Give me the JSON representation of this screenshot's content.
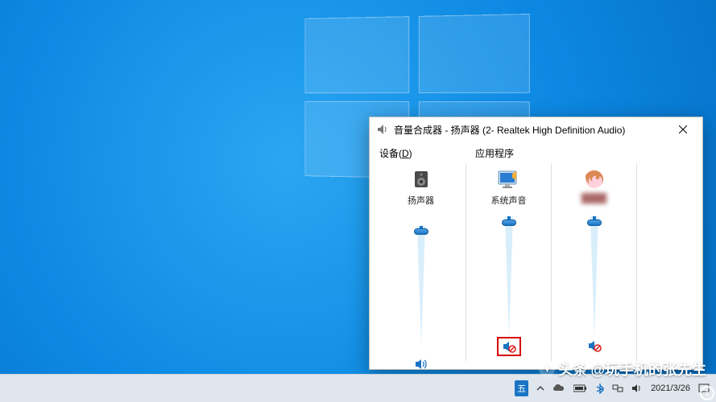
{
  "window": {
    "title": "音量合成器 - 扬声器 (2- Realtek High Definition Audio)"
  },
  "sections": {
    "device_label_prefix": "设备(",
    "device_label_key": "D",
    "device_label_suffix": ")",
    "apps_label": "应用程序"
  },
  "columns": [
    {
      "name": "扬声器",
      "volume": 95,
      "muted": false,
      "icon": "speaker-device"
    },
    {
      "name": "系统声音",
      "volume": 95,
      "muted": true,
      "icon": "system-sounds",
      "highlight": true
    },
    {
      "name": "████",
      "volume": 95,
      "muted": true,
      "icon": "firefox",
      "blurred": true
    }
  ],
  "taskbar": {
    "lang": "五",
    "date": "2021/3/26"
  },
  "watermark": {
    "prefix": "头条",
    "handle": "@玩手机的张先生"
  },
  "corner_badge": "1"
}
